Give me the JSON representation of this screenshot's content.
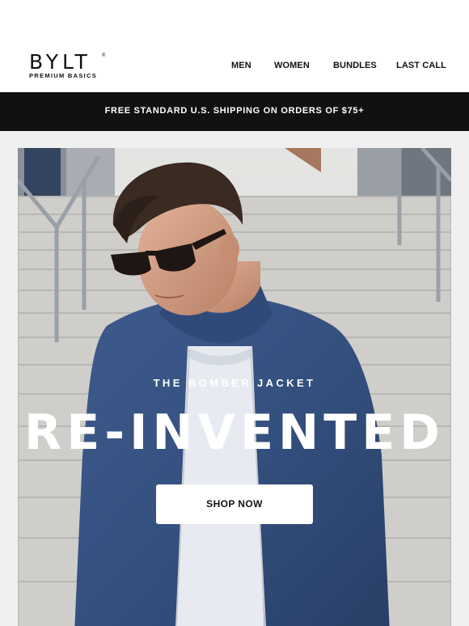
{
  "brand": {
    "logo_text": "BYLT",
    "tagline": "PREMIUM BASICS",
    "registered_mark": "®"
  },
  "nav": {
    "items": [
      {
        "label": "MEN"
      },
      {
        "label": "WOMEN"
      },
      {
        "label": "BUNDLES"
      },
      {
        "label": "LAST CALL"
      }
    ]
  },
  "promo_bar": {
    "text": "FREE STANDARD U.S. SHIPPING ON ORDERS OF $75+"
  },
  "hero": {
    "kicker": "THE BOMBER JACKET",
    "headline": "RE-INVENTED",
    "cta_label": "SHOP NOW"
  },
  "colors": {
    "header_bg": "#ffffff",
    "promo_bg": "#111111",
    "page_bg": "#f0f0f0",
    "jacket_navy": "#34507f",
    "cta_bg": "#ffffff"
  }
}
